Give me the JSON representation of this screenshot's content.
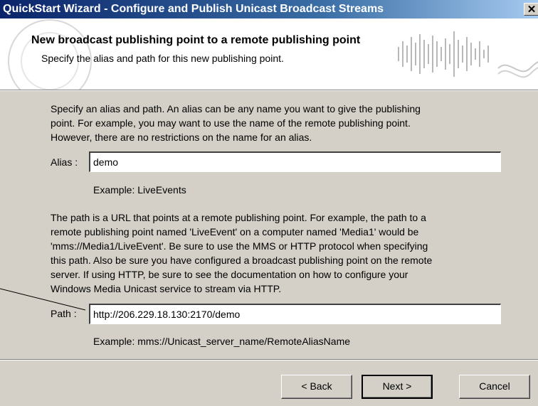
{
  "window": {
    "title": "QuickStart Wizard - Configure and Publish Unicast Broadcast Streams",
    "close_glyph": "✕"
  },
  "header": {
    "title": "New broadcast publishing point to a remote publishing point",
    "subtitle": "Specify the alias and path for this new publishing point."
  },
  "intro_lines": [
    "Specify an alias and path.  An alias can be any name you want to give the publishing",
    "point.  For example, you may want to use the name of the remote publishing point.",
    "However, there are no restrictions on the name for an alias."
  ],
  "alias": {
    "label": "Alias :",
    "value": "demo",
    "example": "Example: LiveEvents"
  },
  "path_help_lines": [
    "The path is a URL that points at a remote publishing point.  For example, the path to a",
    "remote publishing point named 'LiveEvent' on a computer named 'Media1' would be",
    "'mms://Media1/LiveEvent'.  Be sure to use the MMS or HTTP protocol when specifying",
    "this path.  Also be sure you have configured a broadcast publishing point on the remote",
    "server.  If using HTTP, be sure to see the documentation on how to configure your",
    "Windows Media Unicast service to stream via HTTP."
  ],
  "path": {
    "label": "Path :",
    "value": "http://206.229.18.130:2170/demo",
    "example": "Example:  mms://Unicast_server_name/RemoteAliasName"
  },
  "buttons": {
    "back": "< Back",
    "next": "Next >",
    "cancel": "Cancel"
  },
  "colors": {
    "dialog_bg": "#d4d0c8",
    "titlebar_start": "#0a246a",
    "titlebar_end": "#a6caf0"
  }
}
